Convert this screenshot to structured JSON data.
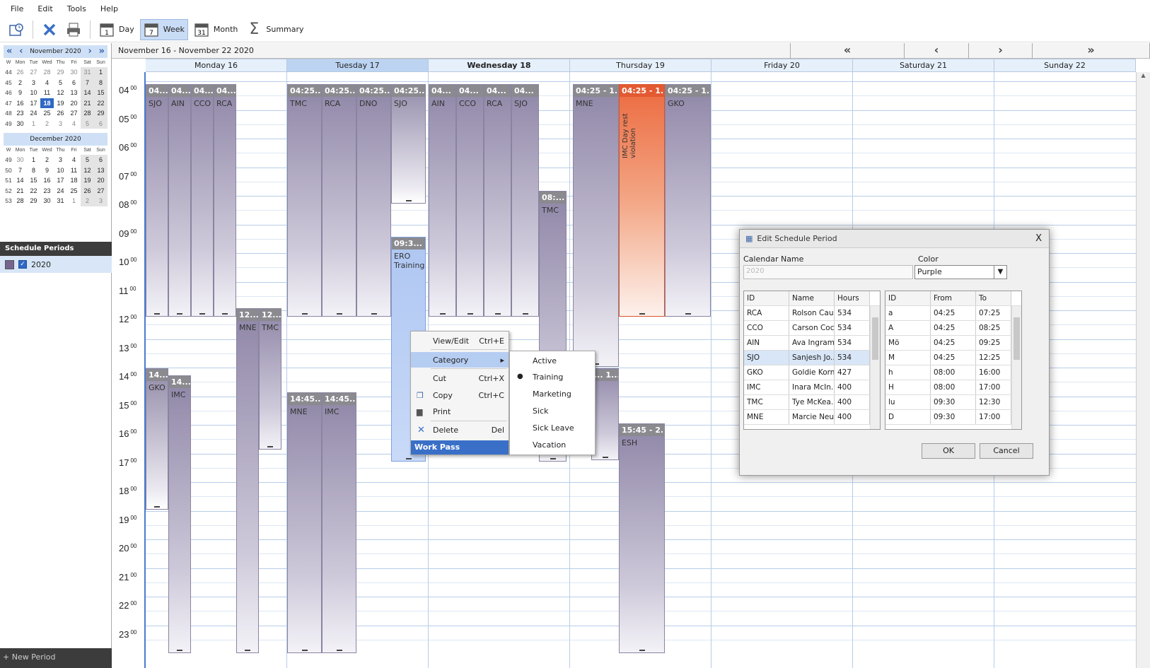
{
  "menu": [
    "File",
    "Edit",
    "Tools",
    "Help"
  ],
  "toolbar": {
    "day": "Day",
    "week": "Week",
    "month": "Month",
    "summary": "Summary",
    "day_icon_num": "1",
    "week_icon_num": "7",
    "month_icon_num": "31"
  },
  "mini_nov": {
    "title": "November 2020",
    "dow": [
      "W",
      "Mon",
      "Tue",
      "Wed",
      "Thu",
      "Fri",
      "Sat",
      "Sun"
    ],
    "weeks": [
      [
        "44",
        "26",
        "27",
        "28",
        "29",
        "30",
        "31",
        "1"
      ],
      [
        "45",
        "2",
        "3",
        "4",
        "5",
        "6",
        "7",
        "8"
      ],
      [
        "46",
        "9",
        "10",
        "11",
        "12",
        "13",
        "14",
        "15"
      ],
      [
        "47",
        "16",
        "17",
        "18",
        "19",
        "20",
        "21",
        "22"
      ],
      [
        "48",
        "23",
        "24",
        "25",
        "26",
        "27",
        "28",
        "29"
      ],
      [
        "49",
        "30",
        "1",
        "2",
        "3",
        "4",
        "5",
        "6"
      ]
    ]
  },
  "mini_dec": {
    "title": "December 2020",
    "dow": [
      "W",
      "Mon",
      "Tue",
      "Wed",
      "Thu",
      "Fri",
      "Sat",
      "Sun"
    ],
    "weeks": [
      [
        "49",
        "30",
        "1",
        "2",
        "3",
        "4",
        "5",
        "6"
      ],
      [
        "50",
        "7",
        "8",
        "9",
        "10",
        "11",
        "12",
        "13"
      ],
      [
        "51",
        "14",
        "15",
        "16",
        "17",
        "18",
        "19",
        "20"
      ],
      [
        "52",
        "21",
        "22",
        "23",
        "24",
        "25",
        "26",
        "27"
      ],
      [
        "53",
        "28",
        "29",
        "30",
        "31",
        "1",
        "2",
        "3"
      ]
    ]
  },
  "schedule_periods": {
    "title": "Schedule Periods",
    "item": "2020",
    "new": "+ New Period",
    "color": "#76668f"
  },
  "range_label": "November 16 - November 22 2020",
  "range_nav": [
    "«",
    "‹",
    "›",
    "»"
  ],
  "days": [
    "Monday  16",
    "Tuesday  17",
    "Wednesday  18",
    "Thursday  19",
    "Friday  20",
    "Saturday  21",
    "Sunday  22"
  ],
  "hours": [
    "04",
    "05",
    "06",
    "07",
    "08",
    "09",
    "10",
    "11",
    "12",
    "13",
    "14",
    "15",
    "16",
    "17",
    "18",
    "19",
    "20",
    "21",
    "22",
    "23"
  ],
  "minutes": "00",
  "appts": [
    {
      "h": "04...",
      "b": "SJO"
    },
    {
      "h": "04...",
      "b": "AIN"
    },
    {
      "h": "04...",
      "b": "CCO"
    },
    {
      "h": "04...",
      "b": "RCA"
    },
    {
      "h": "12...",
      "b": "MNE"
    },
    {
      "h": "12...",
      "b": "TMC"
    },
    {
      "h": "14...",
      "b": "GKO"
    },
    {
      "h": "14...",
      "b": "IMC"
    },
    {
      "h": "04:25...",
      "b": "TMC"
    },
    {
      "h": "04:25...",
      "b": "RCA"
    },
    {
      "h": "04:25...",
      "b": "DNO"
    },
    {
      "h": "04:25...",
      "b": "SJO"
    },
    {
      "h": "09:3...",
      "b": "ERO Training"
    },
    {
      "h": "14:45...",
      "b": "MNE"
    },
    {
      "h": "14:45...",
      "b": "IMC"
    },
    {
      "h": "04...",
      "b": "AIN"
    },
    {
      "h": "04...",
      "b": "CCO"
    },
    {
      "h": "04...",
      "b": "RCA"
    },
    {
      "h": "04...",
      "b": "SJO"
    },
    {
      "h": "08:...",
      "b": "TMC"
    },
    {
      "h": "04:25 - 1...",
      "b": "MNE"
    },
    {
      "h": "04:25 - 1...",
      "b": "IMC Day rest violation"
    },
    {
      "h": "04:25 - 1...",
      "b": "GKO"
    },
    {
      "h": "... 1...",
      "b": ""
    },
    {
      "h": "15:45 - 2...",
      "b": "ESH"
    }
  ],
  "context_menu": {
    "items": [
      {
        "label": "View/Edit",
        "sc": "Ctrl+E"
      },
      {
        "label": "Category",
        "sc": "▸"
      },
      {
        "label": "Cut",
        "sc": "Ctrl+X"
      },
      {
        "label": "Copy",
        "sc": "Ctrl+C"
      },
      {
        "label": "Print",
        "sc": ""
      },
      {
        "label": "Delete",
        "sc": "Del"
      }
    ],
    "footer": "Work Pass"
  },
  "submenu": [
    "Active",
    "Training",
    "Marketing",
    "Sick",
    "Sick Leave",
    "Vacation"
  ],
  "dialog": {
    "title": "Edit Schedule Period",
    "calname_label": "Calendar Name",
    "calname_value": "2020",
    "color_label": "Color",
    "color_value": "Purple",
    "left_cols": [
      "ID",
      "Name",
      "Hours"
    ],
    "left_rows": [
      [
        "RCA",
        "Rolson Cau...",
        "534"
      ],
      [
        "CCO",
        "Carson Coc...",
        "534"
      ],
      [
        "AIN",
        "Ava Ingram",
        "534"
      ],
      [
        "SJO",
        "Sanjesh Jo...",
        "534"
      ],
      [
        "GKO",
        "Goldie Korn",
        "427"
      ],
      [
        "IMC",
        "Inara McIn...",
        "400"
      ],
      [
        "TMC",
        "Tye McKea...",
        "400"
      ],
      [
        "MNE",
        "Marcie Neu...",
        "400"
      ]
    ],
    "right_cols": [
      "ID",
      "From",
      "To"
    ],
    "right_rows": [
      [
        "a",
        "04:25",
        "07:25"
      ],
      [
        "A",
        "04:25",
        "08:25"
      ],
      [
        "Mö",
        "04:25",
        "09:25"
      ],
      [
        "M",
        "04:25",
        "12:25"
      ],
      [
        "h",
        "08:00",
        "16:00"
      ],
      [
        "H",
        "08:00",
        "17:00"
      ],
      [
        "lu",
        "09:30",
        "12:30"
      ],
      [
        "D",
        "09:30",
        "17:00"
      ]
    ],
    "ok": "OK",
    "cancel": "Cancel"
  }
}
